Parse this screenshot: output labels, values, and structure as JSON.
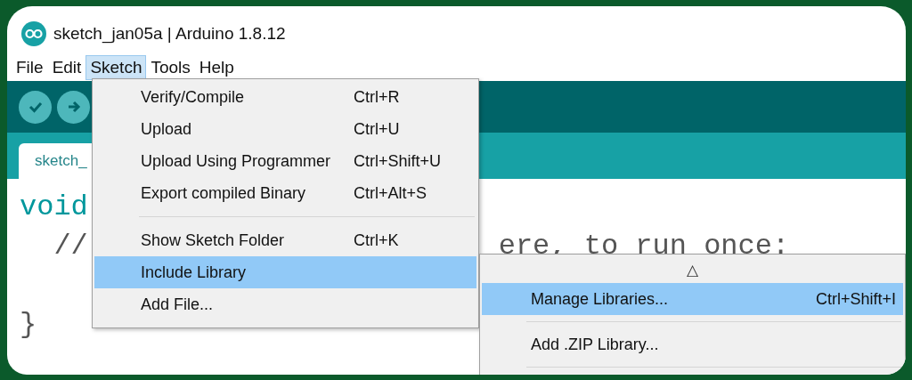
{
  "window": {
    "title": "sketch_jan05a | Arduino 1.8.12"
  },
  "menubar": [
    {
      "label": "File",
      "selected": false
    },
    {
      "label": "Edit",
      "selected": false
    },
    {
      "label": "Sketch",
      "selected": true
    },
    {
      "label": "Tools",
      "selected": false
    },
    {
      "label": "Help",
      "selected": false
    }
  ],
  "toolbar": {
    "buttons": [
      {
        "kind": "verify"
      },
      {
        "kind": "upload"
      }
    ]
  },
  "tabs": [
    {
      "label": "sketch_",
      "selected": true
    }
  ],
  "editor": {
    "lines": [
      {
        "left": "void"
      },
      {
        "left": "  //",
        "right": "ere, to run once:"
      }
    ],
    "closing": "}"
  },
  "sketch_menu": {
    "items": [
      {
        "kind": "item",
        "label": "Verify/Compile",
        "shortcut": "Ctrl+R",
        "selected": false
      },
      {
        "kind": "item",
        "label": "Upload",
        "shortcut": "Ctrl+U",
        "selected": false
      },
      {
        "kind": "item",
        "label": "Upload Using Programmer",
        "shortcut": "Ctrl+Shift+U",
        "selected": false
      },
      {
        "kind": "item",
        "label": "Export compiled Binary",
        "shortcut": "Ctrl+Alt+S",
        "selected": false
      },
      {
        "kind": "separator"
      },
      {
        "kind": "item",
        "label": "Show Sketch Folder",
        "shortcut": "Ctrl+K",
        "selected": false
      },
      {
        "kind": "submenu",
        "label": "Include Library",
        "selected": true
      },
      {
        "kind": "item",
        "label": "Add File...",
        "selected": false
      }
    ]
  },
  "library_submenu": {
    "scroll_up": "△",
    "items": [
      {
        "kind": "item",
        "label": "Manage Libraries...",
        "shortcut": "Ctrl+Shift+I",
        "selected": true
      },
      {
        "kind": "separator"
      },
      {
        "kind": "item",
        "label": "Add .ZIP Library...",
        "selected": false
      },
      {
        "kind": "separator"
      }
    ]
  }
}
